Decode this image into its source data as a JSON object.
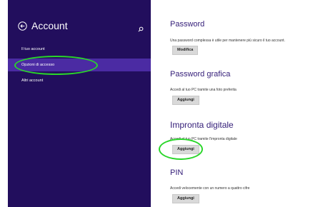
{
  "sidebar": {
    "title": "Account",
    "items": [
      {
        "label": "Il tuo account"
      },
      {
        "label": "Opzioni di accesso"
      },
      {
        "label": "Altri account"
      }
    ]
  },
  "main": {
    "password": {
      "title": "Password",
      "description": "Una password complessa è utile per mantenere più sicuro il tuo account.",
      "button": "Modifica"
    },
    "picture_password": {
      "title": "Password grafica",
      "description": "Accedi al tuo PC tramite una foto preferita",
      "button": "Aggiungi"
    },
    "fingerprint": {
      "title": "Impronta digitale",
      "description": "Accedi al tuo PC tramite l'impronta digitale",
      "button": "Aggiungi"
    },
    "pin": {
      "title": "PIN",
      "description": "Accedi velocemente con un numero a quattro cifre",
      "button": "Aggiungi"
    }
  },
  "colors": {
    "sidebar_bg": "#220e5d",
    "active_item_bg": "#4b2ba3",
    "accent_title": "#36207a",
    "highlight": "#2ad62a"
  },
  "icons": {
    "back": "back-arrow-circle-icon",
    "search": "search-icon"
  }
}
